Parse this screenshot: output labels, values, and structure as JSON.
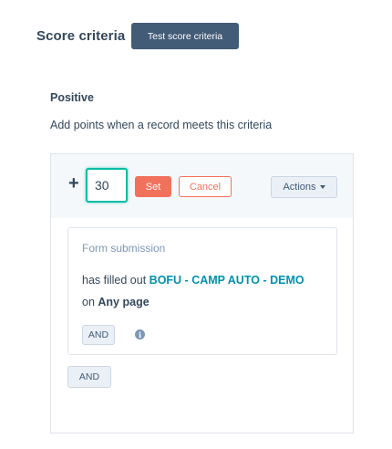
{
  "header": {
    "title": "Score criteria",
    "test_button_label": "Test score criteria"
  },
  "section": {
    "heading": "Positive",
    "description": "Add points when a record meets this criteria"
  },
  "editor": {
    "plus_symbol": "+",
    "points_value": "30",
    "set_label": "Set",
    "cancel_label": "Cancel",
    "actions_label": "Actions"
  },
  "criteria": {
    "type_label": "Form submission",
    "prefix": "has filled out",
    "form_name": "BOFU - CAMP AUTO - DEMO",
    "on_text": "on",
    "page_value": "Any page",
    "and_label": "AND"
  },
  "outer_and_label": "AND",
  "colors": {
    "accent_dark": "#425b76",
    "set_button": "#f2715c",
    "link": "#0091ae",
    "focus_border": "#00bda5",
    "panel_bg": "#f5f8fa"
  },
  "icons": {
    "plus": "plus-icon",
    "actions_caret": "caret-down-icon",
    "info": "info-icon"
  }
}
